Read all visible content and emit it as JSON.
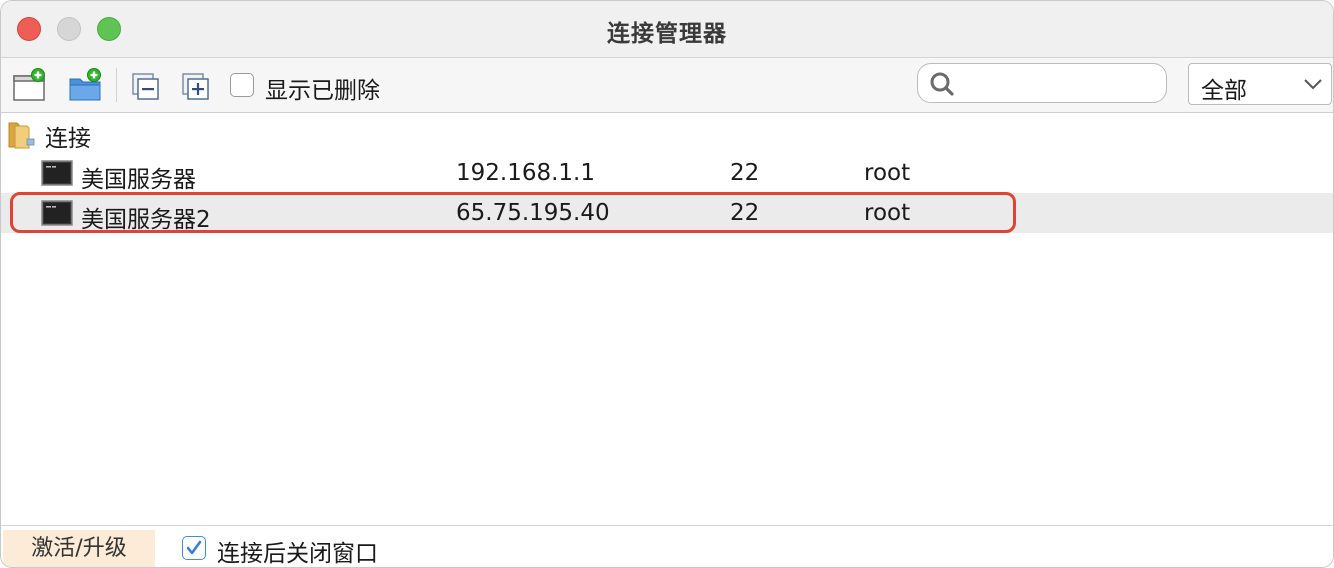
{
  "window": {
    "title": "连接管理器"
  },
  "toolbar": {
    "new_connection_icon": "new-connection-icon",
    "new_folder_icon": "new-folder-icon",
    "collapse_icon": "collapse-all-icon",
    "expand_icon": "expand-all-icon",
    "show_deleted_label": "显示已删除",
    "show_deleted_checked": false,
    "search": {
      "placeholder": "",
      "value": ""
    },
    "filter": {
      "selected": "全部"
    }
  },
  "tree": {
    "folder": {
      "label": "连接"
    },
    "connections": [
      {
        "name": "美国服务器",
        "host": "192.168.1.1",
        "port": "22",
        "user": "root"
      },
      {
        "name": "美国服务器2",
        "host": "65.75.195.40",
        "port": "22",
        "user": "root"
      }
    ]
  },
  "statusbar": {
    "activate_label": "激活/升级",
    "close_after_connect_label": "连接后关闭窗口",
    "close_after_connect_checked": true
  },
  "colors": {
    "highlight": "#e0432e",
    "selected_row": "#ebebeb",
    "activate_bg": "#fbebd7",
    "checkbox_accent": "#3d8ce8"
  }
}
